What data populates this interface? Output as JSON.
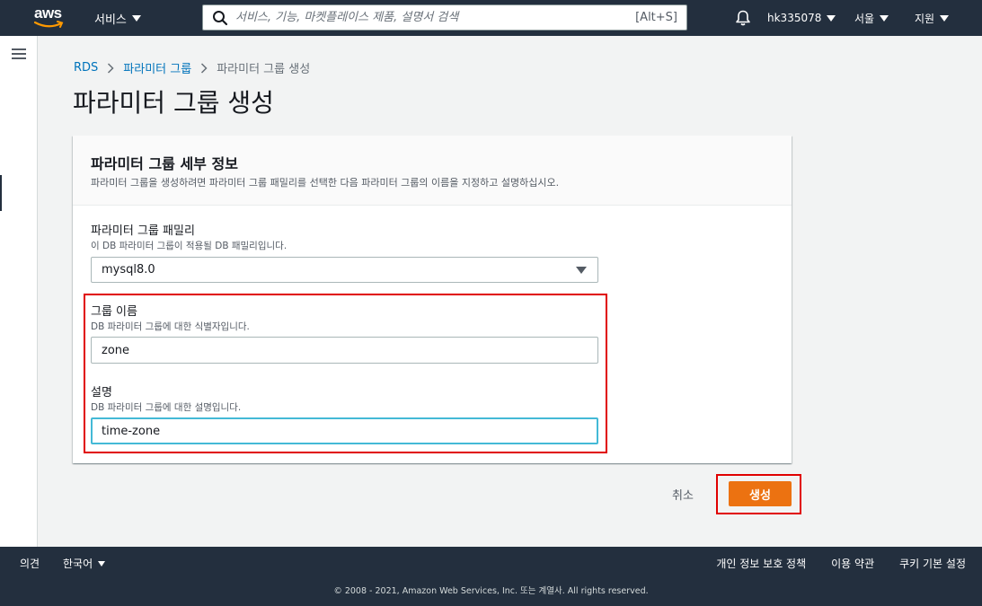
{
  "topnav": {
    "logo_text": "aws",
    "services_label": "서비스",
    "search": {
      "placeholder": "서비스, 기능, 마켓플레이스 제품, 설명서 검색",
      "shortcut": "[Alt+S]"
    },
    "user_label": "hk335078",
    "region_label": "서울",
    "support_label": "지원"
  },
  "breadcrumb": {
    "items": [
      "RDS",
      "파라미터 그룹",
      "파라미터 그룹 생성"
    ]
  },
  "page_title": "파라미터 그룹 생성",
  "card": {
    "title": "파라미터 그룹 세부 정보",
    "description": "파라미터 그룹을 생성하려면 파라미터 그룹 패밀리를 선택한 다음 파라미터 그룹의 이름을 지정하고 설명하십시오.",
    "family": {
      "label": "파라미터 그룹 패밀리",
      "description": "이 DB 파라미터 그룹이 적용될 DB 패밀리입니다.",
      "value": "mysql8.0"
    },
    "group_name": {
      "label": "그룹 이름",
      "description": "DB 파라미터 그룹에 대한 식별자입니다.",
      "value": "zone"
    },
    "description_field": {
      "label": "설명",
      "description": "DB 파라미터 그룹에 대한 설명입니다.",
      "value": "time-zone"
    }
  },
  "actions": {
    "cancel_label": "취소",
    "create_label": "생성"
  },
  "footer": {
    "feedback": "의견",
    "language": "한국어",
    "links": [
      "개인 정보 보호 정책",
      "이용 약관",
      "쿠키 기본 설정"
    ],
    "copyright": "© 2008 - 2021, Amazon Web Services, Inc. 또는 계열사. All rights reserved."
  },
  "colors": {
    "nav_bg": "#232f3e",
    "accent_orange": "#ec7211",
    "link_blue": "#0073bb",
    "focus_blue": "#44b9d6",
    "annotation_red": "#e00000"
  },
  "icons": [
    "aws-smile-icon",
    "services-caret-icon",
    "search-icon",
    "bell-icon",
    "hamburger-menu-icon",
    "breadcrumb-chevron-icon",
    "select-arrow-icon"
  ]
}
